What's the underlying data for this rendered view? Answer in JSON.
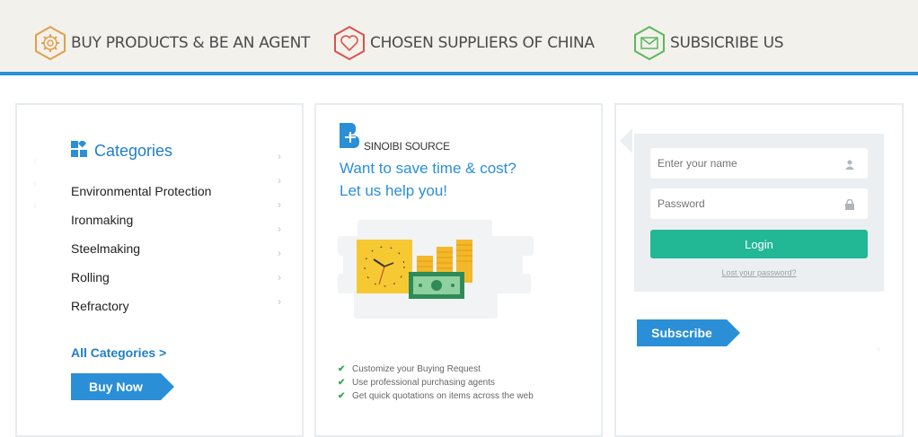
{
  "topbar": {
    "items": [
      {
        "label": "BUY PRODUCTS & BE AN AGENT",
        "icon": "gear-icon",
        "color": "#e0a04a"
      },
      {
        "label": "CHOSEN SUPPLIERS OF CHINA",
        "icon": "heart-icon",
        "color": "#d9534f"
      },
      {
        "label": "SUBSICRIBE US",
        "icon": "envelope-icon",
        "color": "#5cb85c"
      }
    ],
    "accent_line_color": "#2a8fd6"
  },
  "categories": {
    "title": "Categories",
    "items": [
      "Environmental Protection",
      "Ironmaking",
      "Steelmaking",
      "Rolling",
      "Refractory"
    ],
    "all_link": "All Categories  >",
    "buy_button": "Buy Now"
  },
  "promo": {
    "brand": "SINOIBI SOURCE",
    "headline_1": "Want to save time & cost?",
    "headline_2": "Let us help you!",
    "features": [
      "Customize your Buying Request",
      "Use professional purchasing agents",
      "Get quick quotations on items across the web"
    ]
  },
  "login": {
    "name_placeholder": "Enter your name",
    "password_placeholder": "Password",
    "login_button": "Login",
    "lost_password": "Lost your password?",
    "subscribe_button": "Subscribe"
  },
  "colors": {
    "primary": "#2a8fd6",
    "login_green": "#22b795",
    "check_green": "#35a853"
  }
}
